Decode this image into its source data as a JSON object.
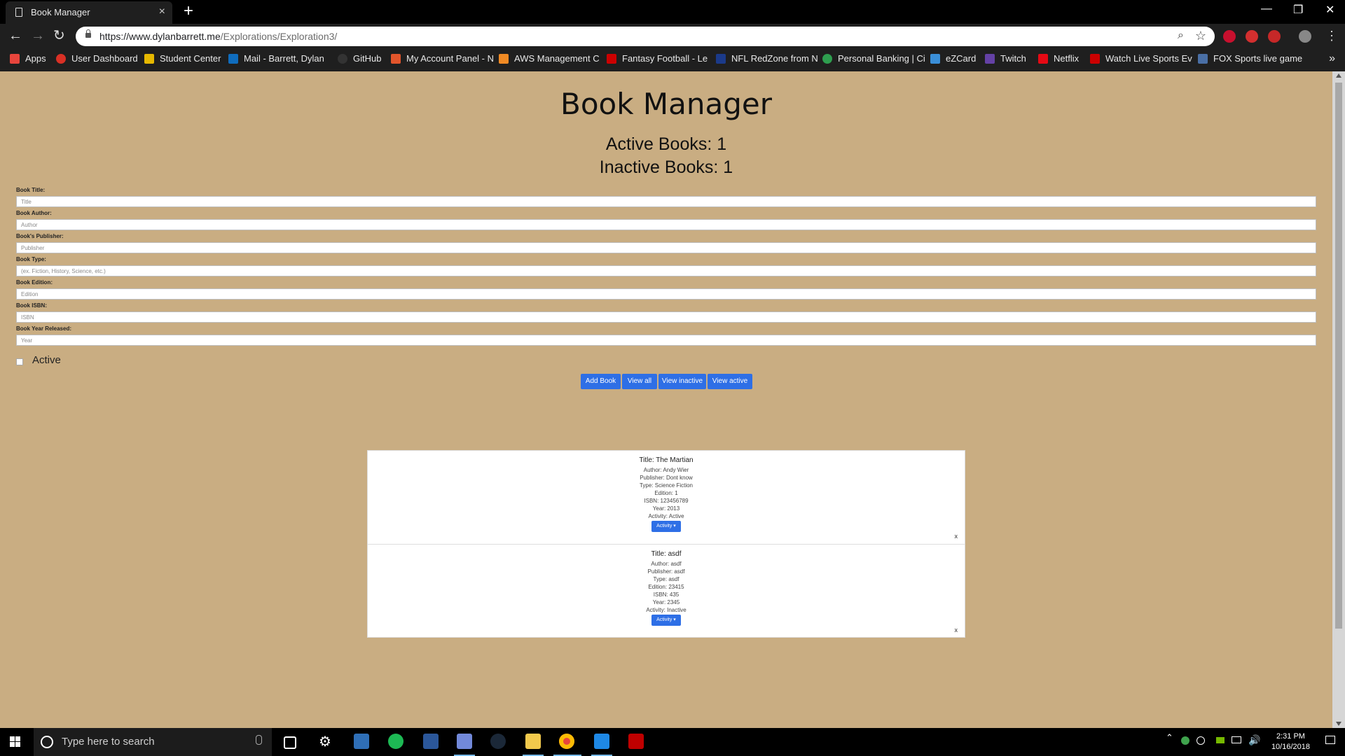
{
  "browser": {
    "tab_title": "Book Manager",
    "tab_close": "×",
    "new_tab": "+",
    "url_main": "https://www.dylanbarrett.me",
    "url_path": "/Explorations/Exploration3/",
    "bookmarks": [
      {
        "label": "Apps",
        "icon": "apps-grid-icon",
        "color": "#e8453c"
      },
      {
        "label": "User Dashboard",
        "icon": "dashboard-icon",
        "color": "#d93025"
      },
      {
        "label": "Student Center",
        "icon": "student-center-icon",
        "color": "#e6b800"
      },
      {
        "label": "Mail - Barrett, Dylan",
        "icon": "outlook-mail-icon",
        "color": "#0f6cbd"
      },
      {
        "label": "GitHub",
        "icon": "github-icon",
        "color": "#333333"
      },
      {
        "label": "My Account Panel - N",
        "icon": "account-panel-icon",
        "color": "#e2552b"
      },
      {
        "label": "AWS Management C",
        "icon": "aws-icon",
        "color": "#f08a24"
      },
      {
        "label": "Fantasy Football - Le",
        "icon": "espn-icon",
        "color": "#cc0000"
      },
      {
        "label": "NFL RedZone from N",
        "icon": "nfl-icon",
        "color": "#1b3a8a"
      },
      {
        "label": "Personal Banking | Ci",
        "icon": "bank-icon",
        "color": "#2e9e4f"
      },
      {
        "label": "eZCard",
        "icon": "ezcard-icon",
        "color": "#3a8fd8"
      },
      {
        "label": "Twitch",
        "icon": "twitch-icon",
        "color": "#6441a5"
      },
      {
        "label": "Netflix",
        "icon": "netflix-icon",
        "color": "#e50914"
      },
      {
        "label": "Watch Live Sports Ev",
        "icon": "espn-watch-icon",
        "color": "#cc0000"
      },
      {
        "label": "FOX Sports live game",
        "icon": "fox-sports-icon",
        "color": "#4a6fa5"
      }
    ]
  },
  "page": {
    "title": "Book Manager",
    "active_count": "Active Books: 1",
    "inactive_count": "Inactive Books: 1",
    "form": [
      {
        "label": "Book Title:",
        "placeholder": "Title"
      },
      {
        "label": "Book Author:",
        "placeholder": "Author"
      },
      {
        "label": "Book's Publisher:",
        "placeholder": "Publisher"
      },
      {
        "label": "Book Type:",
        "placeholder": "(ex. Fiction, History, Science, etc.)"
      },
      {
        "label": "Book Edition:",
        "placeholder": "Edition"
      },
      {
        "label": "Book ISBN:",
        "placeholder": "ISBN"
      },
      {
        "label": "Book Year Released:",
        "placeholder": "Year"
      }
    ],
    "active_label": "Active",
    "buttons": {
      "add": "Add Book",
      "view_all": "View all",
      "view_inactive": "View inactive",
      "view_active": "View active"
    },
    "books": [
      {
        "title": "Title: The Martian",
        "author": "Author: Andy Wier",
        "publisher": "Publisher: Dont know",
        "type": "Type: Science Fiction",
        "edition": "Edition: 1",
        "isbn": "ISBN: 123456789",
        "year": "Year: 2013",
        "activity": "Activity: Active",
        "button": "Activity ▾",
        "remove": "x"
      },
      {
        "title": "Title: asdf",
        "author": "Author: asdf",
        "publisher": "Publisher: asdf",
        "type": "Type: asdf",
        "edition": "Edition: 23415",
        "isbn": "ISBN: 435",
        "year": "Year: 2345",
        "activity": "Activity: Inactive",
        "button": "Activity ▾",
        "remove": "x"
      }
    ]
  },
  "taskbar": {
    "search_placeholder": "Type here to search",
    "time": "2:31 PM",
    "date": "10/16/2018"
  },
  "colors": {
    "page_bg": "#c9ad82",
    "button_blue": "#2e6fe6"
  }
}
